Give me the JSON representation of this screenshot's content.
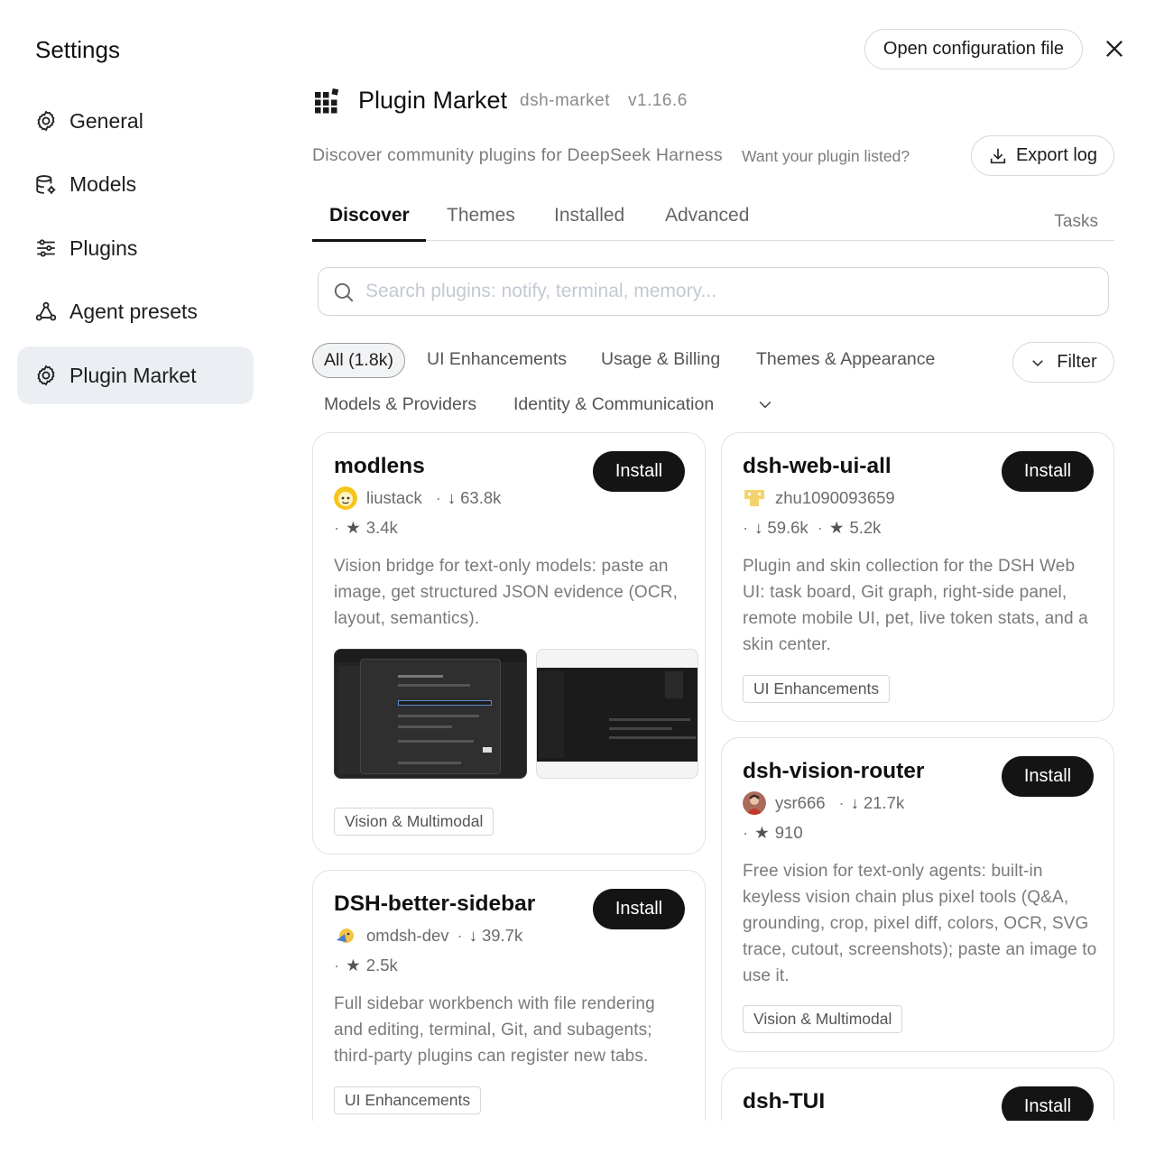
{
  "settings": {
    "title": "Settings",
    "nav": [
      {
        "label": "General",
        "icon": "gear-icon"
      },
      {
        "label": "Models",
        "icon": "database-gear-icon"
      },
      {
        "label": "Plugins",
        "icon": "sliders-icon"
      },
      {
        "label": "Agent presets",
        "icon": "nodes-icon"
      },
      {
        "label": "Plugin Market",
        "icon": "gear-icon",
        "active": true
      }
    ]
  },
  "toolbar": {
    "open_config_label": "Open configuration file",
    "close_icon": "close-icon"
  },
  "header": {
    "title": "Plugin Market",
    "market_id": "dsh-market",
    "version": "v1.16.6",
    "subtitle": "Discover community plugins for DeepSeek Harness",
    "want_listed": "Want your plugin listed?",
    "export_label": "Export log"
  },
  "tabs": {
    "items": [
      "Discover",
      "Themes",
      "Installed",
      "Advanced"
    ],
    "active": "Discover",
    "tasks": "Tasks"
  },
  "search": {
    "placeholder": "Search plugins: notify, terminal, memory..."
  },
  "categories": {
    "row1": [
      "All (1.8k)",
      "UI Enhancements",
      "Usage & Billing",
      "Themes & Appearance"
    ],
    "row2": [
      "Models & Providers",
      "Identity & Communication"
    ],
    "active": "All (1.8k)",
    "filter_label": "Filter"
  },
  "colors": {
    "accent": "#141414",
    "active_nav_bg": "#ebeef3",
    "muted_text": "#7a7a7a"
  },
  "plugins": [
    {
      "name": "modlens",
      "author": "liustack",
      "downloads": "63.8k",
      "stars": "3.4k",
      "description": "Vision bridge for text-only models: paste an image, get structured JSON evidence (OCR, layout, semantics).",
      "tag": "Vision & Multimodal",
      "install_label": "Install"
    },
    {
      "name": "dsh-web-ui-all",
      "author": "zhu1090093659",
      "downloads": "59.6k",
      "stars": "5.2k",
      "description": "Plugin and skin collection for the DSH Web UI: task board, Git graph, right-side panel, remote mobile UI, pet, live token stats, and a skin center.",
      "tag": "UI Enhancements",
      "install_label": "Install"
    },
    {
      "name": "dsh-vision-router",
      "author": "ysr666",
      "downloads": "21.7k",
      "stars": "910",
      "description": "Free vision for text-only agents: built-in keyless vision chain plus pixel tools (Q&A, grounding, crop, pixel diff, colors, OCR, SVG trace, cutout, screenshots); paste an image to use it.",
      "tag": "Vision & Multimodal",
      "install_label": "Install"
    },
    {
      "name": "DSH-better-sidebar",
      "author": "omdsh-dev",
      "downloads": "39.7k",
      "stars": "2.5k",
      "description": "Full sidebar workbench with file rendering and editing, terminal, Git, and subagents; third-party plugins can register new tabs.",
      "tag": "UI Enhancements",
      "install_label": "Install"
    },
    {
      "name": "dsh-TUI",
      "install_label": "Install"
    }
  ]
}
